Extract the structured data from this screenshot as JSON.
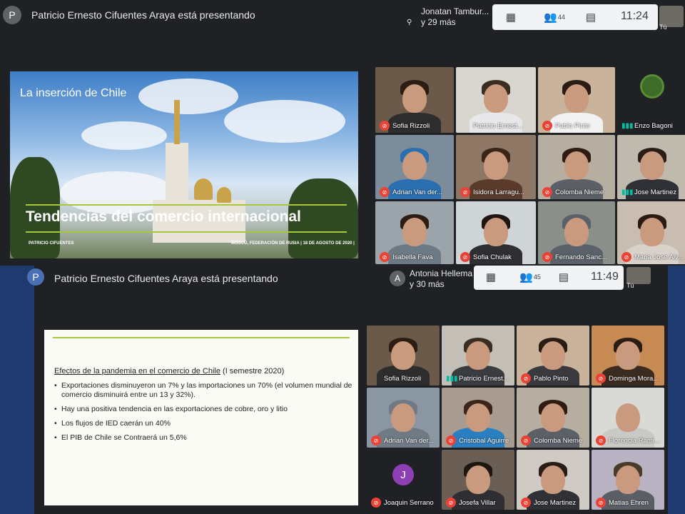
{
  "shot1": {
    "presenter_initial": "P",
    "presenting_text": "Patricio Ernesto Cifuentes Araya está presentando",
    "participants_name": "Jonatan Tambur...",
    "participants_more": "y 29 más",
    "people_count": "44",
    "time": "11:24",
    "self_label": "Tú",
    "slide": {
      "small_title": "La inserción de Chile",
      "big_title": "Tendencias del comercio internacional",
      "footer_left": "PATRICIO CIFUENTES",
      "footer_right": "MOSCÚ, FEDERACIÓN DE RUSIA | 18 DE AGOSTO DE 2020 |"
    },
    "tiles": [
      {
        "name": "Sofia Rizzoli",
        "muted": true,
        "bg": "#6b5a4a",
        "hair": "#2b1d14",
        "body": "#2d2d2d"
      },
      {
        "name": "Patricio Ernest...",
        "muted": false,
        "bg": "#d9d6cf",
        "hair": "#3a2d22",
        "body": "#e8e8ea"
      },
      {
        "name": "Pablo Pinto",
        "muted": true,
        "bg": "#c9b39a",
        "hair": "#2a1c12",
        "body": "#f2f2f2"
      },
      {
        "name": "Enzo Bagoni",
        "muted": false,
        "speaking": true,
        "avatar": true,
        "bg": "#202124"
      },
      {
        "name": "Adrian Van der...",
        "muted": true,
        "bg": "#7c8c9a",
        "hair": "#2a6fb0",
        "body": "#2a6fb0"
      },
      {
        "name": "Isidora Larragu...",
        "muted": true,
        "bg": "#8f7766",
        "hair": "#3b2418",
        "body": "#5a3b2b"
      },
      {
        "name": "Colomba Nieme",
        "muted": true,
        "bg": "#b7aea2",
        "hair": "#2e1b12",
        "body": "#5b5f66"
      },
      {
        "name": "Jose Martinez",
        "muted": false,
        "speaking": true,
        "bg": "#bfb9ae",
        "hair": "#2a1d16",
        "body": "#2f3136"
      },
      {
        "name": "Isabella Fava",
        "muted": true,
        "bg": "#9aa4aa",
        "hair": "#2b1d14",
        "body": "#6c7a86"
      },
      {
        "name": "Sofia Chulak",
        "muted": true,
        "bg": "#cfd4d6",
        "hair": "#1f1611",
        "body": "#2f2f33"
      },
      {
        "name": "Fernando Sanc...",
        "muted": true,
        "bg": "#8b8f8a",
        "hair": "#5b6168",
        "body": "#5b6168"
      },
      {
        "name": "Maria Jose Alv...",
        "muted": true,
        "bg": "#c9bdb1",
        "hair": "#2a1a12",
        "body": "#d8d2cb"
      }
    ]
  },
  "shot2": {
    "presenter_initial": "P",
    "presenting_text": "Patricio Ernesto Cifuentes Araya está presentando",
    "participant_initial": "A",
    "participants_name": "Antonia Hellema",
    "participants_more": "y 30 más",
    "people_count": "45",
    "time": "11:49",
    "self_label": "Tú",
    "slide": {
      "heading_underlined": "Efectos de la pandemia en el comercio de  Chile",
      "heading_rest": " (I semestre 2020)",
      "bullets": [
        "Exportaciones disminuyeron un 7% y las importaciones un 70% (el volumen mundial de comercio disminuirá entre un 13 y 32%).",
        "Hay una positiva tendencia en las exportaciones de cobre, oro y litio",
        "Los flujos de IED caerán un 40%",
        "El PIB de Chile se Contraerá un 5,6%"
      ]
    },
    "tiles": [
      {
        "name": "Sofia Rizzoli",
        "muted": false,
        "bg": "#6b5a4a",
        "hair": "#2b1d14",
        "body": "#2d2d2d"
      },
      {
        "name": "Patricio Ernest...",
        "muted": false,
        "speaking": true,
        "bg": "#c4bfb6",
        "hair": "#3a2d22",
        "body": "#3a3c40"
      },
      {
        "name": "Pablo Pinto",
        "muted": true,
        "bg": "#c9b39a",
        "hair": "#2a1c12",
        "body": "#3a3a3e"
      },
      {
        "name": "Dominga Mora...",
        "muted": true,
        "bg": "#c78a52",
        "hair": "#2b1d14",
        "body": "#3b2a20"
      },
      {
        "name": "Adrian Van der...",
        "muted": true,
        "bg": "#8a96a2",
        "hair": "#6f7a84",
        "body": "#6f7a84"
      },
      {
        "name": "Cristobal Aguirre",
        "muted": true,
        "bg": "#a89c90",
        "hair": "#3b2418",
        "body": "#2a7fc0"
      },
      {
        "name": "Colomba Nieme",
        "muted": true,
        "bg": "#b7aea2",
        "hair": "#2e1b12",
        "body": "#5b5f66"
      },
      {
        "name": "Florencia Rami...",
        "muted": true,
        "bg": "#d9d9d6",
        "hair": "#d9d9d6",
        "body": "#c9c9c6"
      },
      {
        "name": "Joaquin Serrano",
        "muted": true,
        "letter": "J",
        "bg": "#202124"
      },
      {
        "name": "Josefa Villar",
        "muted": true,
        "bg": "#6a5e55",
        "hair": "#1f1611",
        "body": "#2f2f33"
      },
      {
        "name": "Jose Martinez",
        "muted": true,
        "bg": "#cfcac3",
        "hair": "#2a1d16",
        "body": "#2f3136"
      },
      {
        "name": "Matias Ehren",
        "muted": true,
        "bg": "#b9b2c2",
        "hair": "#4a3a2a",
        "body": "#5a5f66"
      }
    ]
  },
  "icons": {
    "mic_off": "mic-off-icon",
    "layout": "grid-layout-icon",
    "people": "people-icon",
    "chat": "chat-icon",
    "speaking": "speaking-indicator-icon",
    "pin": "pin-icon"
  }
}
